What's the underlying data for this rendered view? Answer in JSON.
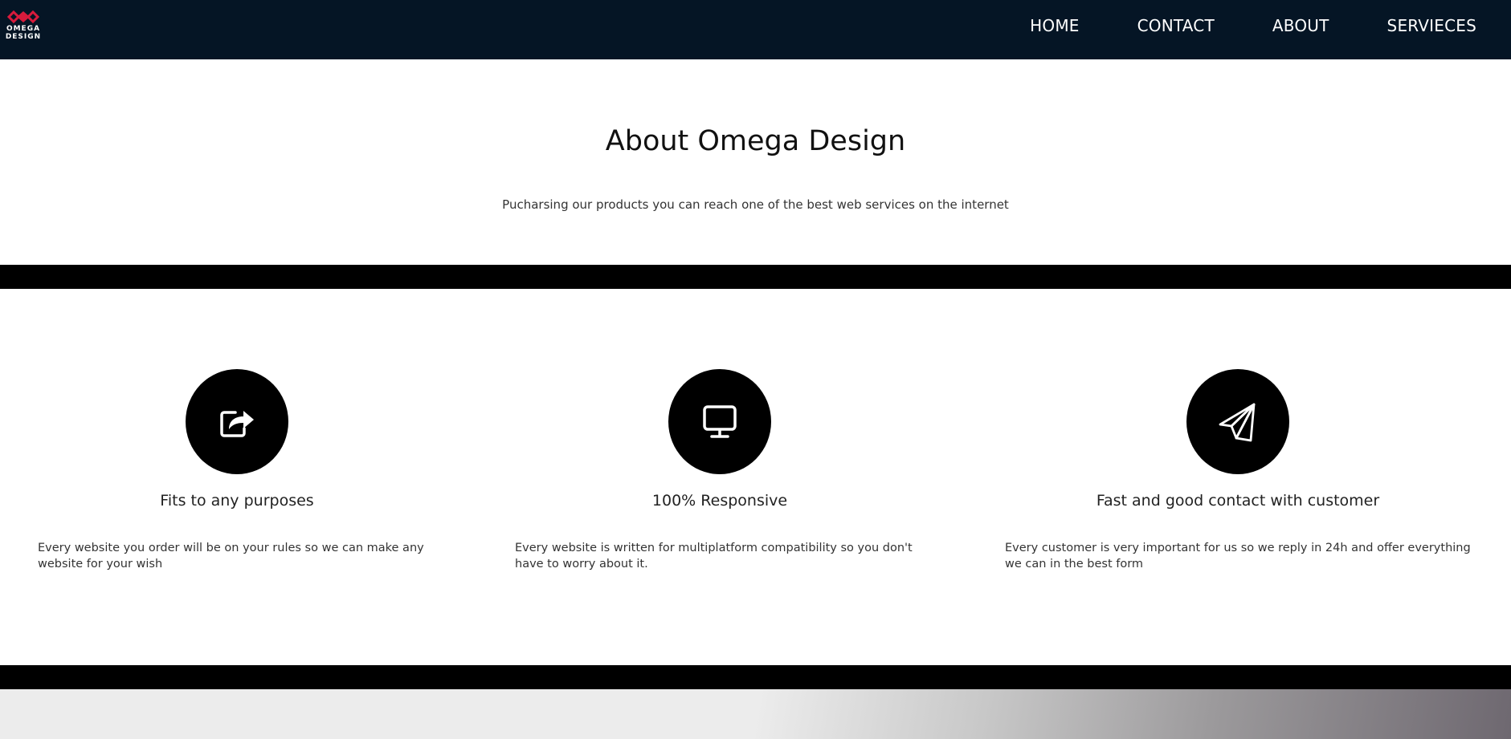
{
  "header": {
    "logo_text_line1": "OMEGA",
    "logo_text_line2": "DESIGN",
    "brand_color": "#d81b3c",
    "background": "#051525",
    "nav": [
      {
        "label": "HOME"
      },
      {
        "label": "CONTACT"
      },
      {
        "label": "ABOUT"
      },
      {
        "label": "SERVIECES"
      }
    ]
  },
  "about": {
    "title": "About Omega Design",
    "subtitle": "Pucharsing our products you can reach one of the best web services on the internet"
  },
  "features": [
    {
      "icon": "share-icon",
      "title": "Fits to any purposes",
      "text": "Every website you order will be on your rules so we can make any website for your wish"
    },
    {
      "icon": "monitor-icon",
      "title": "100% Responsive",
      "text": "Every website is written for multiplatform compatibility so you don't have to worry about it."
    },
    {
      "icon": "paper-plane-icon",
      "title": "Fast and good contact with customer",
      "text": "Every customer is very important for us so we reply in 24h and offer everything we can in the best form"
    }
  ]
}
